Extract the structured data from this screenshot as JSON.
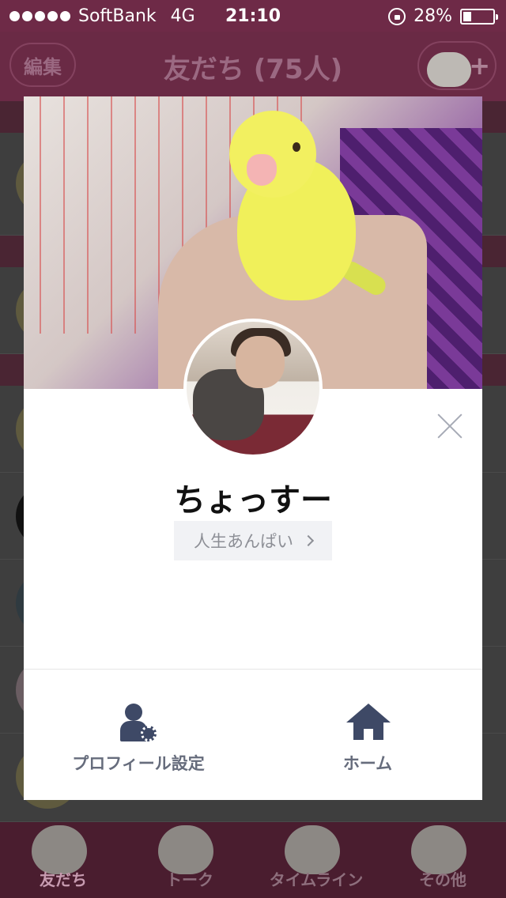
{
  "status_bar": {
    "carrier": "SoftBank",
    "network": "4G",
    "time": "21:10",
    "battery": "28%",
    "battery_level": 0.28
  },
  "nav": {
    "edit_label": "編集",
    "title": "友だち (75人)"
  },
  "profile_card": {
    "name": "ちょっすー",
    "status_message": "人生あんぱい",
    "actions": [
      {
        "label": "プロフィール設定",
        "icon": "profile-settings-icon"
      },
      {
        "label": "ホーム",
        "icon": "home-icon"
      }
    ]
  },
  "tabs": [
    {
      "label": "友だち",
      "active": true
    },
    {
      "label": "トーク",
      "active": false
    },
    {
      "label": "タイムライン",
      "active": false
    },
    {
      "label": "その他",
      "active": false
    }
  ],
  "colors": {
    "accent": "#6e2a47",
    "action_icon": "#3e4966",
    "action_text": "#666c7c"
  }
}
